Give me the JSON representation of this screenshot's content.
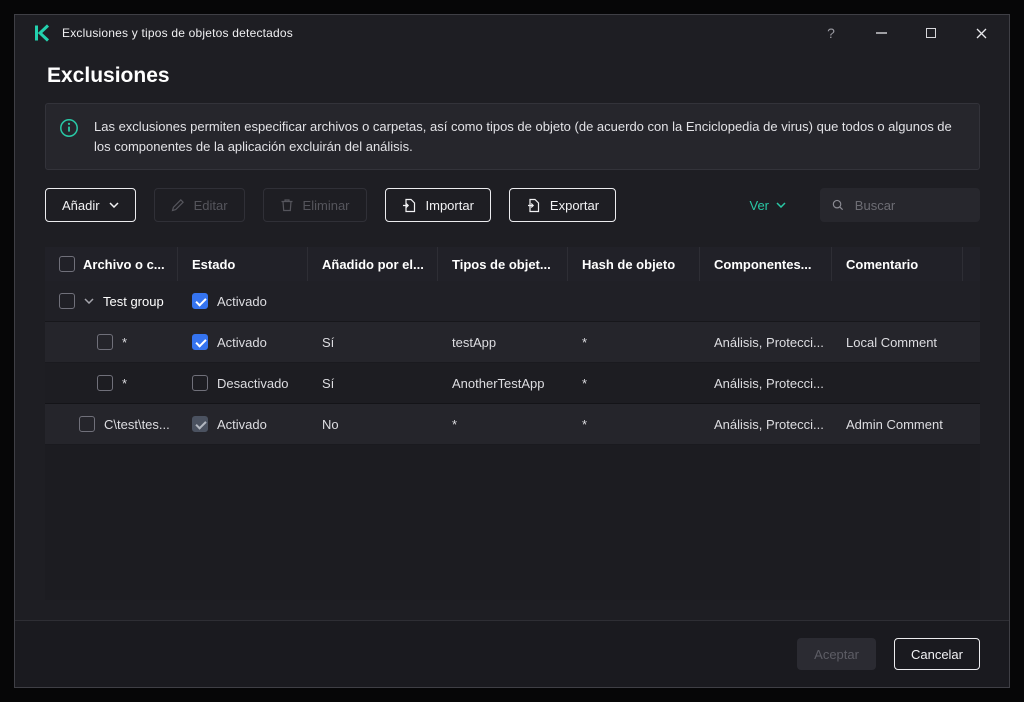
{
  "window": {
    "title": "Exclusiones y tipos de objetos detectados",
    "controls": {
      "help": "?"
    }
  },
  "page": {
    "title": "Exclusiones",
    "info_text": "Las exclusiones permiten especificar archivos o carpetas, así como tipos de objeto (de acuerdo con la Enciclopedia de virus) que todos o algunos de los componentes de la aplicación excluirán del análisis."
  },
  "toolbar": {
    "add": "Añadir",
    "edit": "Editar",
    "delete": "Eliminar",
    "import": "Importar",
    "export": "Exportar",
    "view": "Ver",
    "search_placeholder": "Buscar"
  },
  "table": {
    "columns": [
      "Archivo o c...",
      "Estado",
      "Añadido por el...",
      "Tipos de objet...",
      "Hash de objeto",
      "Componentes...",
      "Comentario"
    ],
    "group": {
      "name": "Test group",
      "status": "Activado",
      "checked": true
    },
    "rows": [
      {
        "file": "*",
        "status": "Activado",
        "status_checked": true,
        "status_disabled": false,
        "added_by": "Sí",
        "object_types": "testApp",
        "hash": "*",
        "components": "Análisis, Protecci...",
        "comment": "Local Comment"
      },
      {
        "file": "*",
        "status": "Desactivado",
        "status_checked": false,
        "status_disabled": false,
        "added_by": "Sí",
        "object_types": "AnotherTestApp",
        "hash": "*",
        "components": "Análisis, Protecci...",
        "comment": ""
      },
      {
        "file": "C\\test\\tes...",
        "status": "Activado",
        "status_checked": true,
        "status_disabled": true,
        "added_by": "No",
        "object_types": "*",
        "hash": "*",
        "components": "Análisis, Protecci...",
        "comment": "Admin Comment"
      }
    ]
  },
  "footer": {
    "ok": "Aceptar",
    "cancel": "Cancelar"
  },
  "colors": {
    "brand_teal": "#23d1ae",
    "checkbox_checked": "#3574f0",
    "checkbox_disabled": "#4b5260",
    "window_bg": "#1e1e23"
  }
}
